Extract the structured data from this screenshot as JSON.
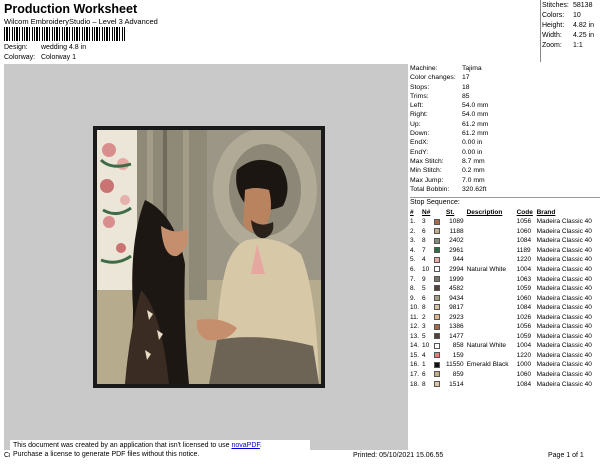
{
  "header": {
    "title": "Production Worksheet",
    "subtitle": "Wilcom EmbroideryStudio – Level 3 Advanced",
    "design_label": "Design:",
    "design_value": "wedding 4.8 in",
    "colorway_label": "Colorway:",
    "colorway_value": "Colorway 1"
  },
  "stats": [
    {
      "k": "Stitches:",
      "v": "58138"
    },
    {
      "k": "Colors:",
      "v": "10"
    },
    {
      "k": "Height:",
      "v": "4.82 in"
    },
    {
      "k": "Width:",
      "v": "4.25 in"
    },
    {
      "k": "Zoom:",
      "v": "1:1"
    }
  ],
  "machine_info": [
    {
      "k": "Machine:",
      "v": "Tajima"
    },
    {
      "k": "Color changes:",
      "v": "17"
    },
    {
      "k": "Stops:",
      "v": "18"
    },
    {
      "k": "Trims:",
      "v": "85"
    },
    {
      "k": "Left:",
      "v": "54.0 mm"
    },
    {
      "k": "Right:",
      "v": "54.0 mm"
    },
    {
      "k": "Up:",
      "v": "61.2 mm"
    },
    {
      "k": "Down:",
      "v": "61.2 mm"
    },
    {
      "k": "EndX:",
      "v": "0.00 in"
    },
    {
      "k": "EndY:",
      "v": "0.00 in"
    },
    {
      "k": "Max Stitch:",
      "v": "8.7 mm"
    },
    {
      "k": "Min Stitch:",
      "v": "0.2 mm"
    },
    {
      "k": "Max Jump:",
      "v": "7.0 mm"
    },
    {
      "k": "Total Bobbin:",
      "v": "320.62ft"
    }
  ],
  "stop_sequence": {
    "title": "Stop Sequence:",
    "headers": {
      "idx": "#",
      "n": "N#",
      "st": "St.",
      "desc": "Description",
      "code": "Code",
      "brand": "Brand"
    },
    "rows": [
      {
        "idx": "1.",
        "n": "3",
        "color": "#a86b4c",
        "st": "1089",
        "desc": "",
        "code": "1056",
        "brand": "Madeira Classic 40"
      },
      {
        "idx": "2.",
        "n": "6",
        "color": "#c6ad8a",
        "st": "1188",
        "desc": "",
        "code": "1060",
        "brand": "Madeira Classic 40"
      },
      {
        "idx": "3.",
        "n": "8",
        "color": "#8b8b7d",
        "st": "2402",
        "desc": "",
        "code": "1084",
        "brand": "Madeira Classic 40"
      },
      {
        "idx": "4.",
        "n": "7",
        "color": "#2f6f47",
        "st": "2961",
        "desc": "",
        "code": "1189",
        "brand": "Madeira Classic 40"
      },
      {
        "idx": "5.",
        "n": "4",
        "color": "#e8aaa4",
        "st": "944",
        "desc": "",
        "code": "1220",
        "brand": "Madeira Classic 40"
      },
      {
        "idx": "6.",
        "n": "10",
        "color": "#ffffff",
        "st": "2994",
        "desc": "Natural White",
        "code": "1004",
        "brand": "Madeira Classic 40"
      },
      {
        "idx": "7.",
        "n": "9",
        "color": "#7e756a",
        "st": "1999",
        "desc": "",
        "code": "1063",
        "brand": "Madeira Classic 40"
      },
      {
        "idx": "8.",
        "n": "5",
        "color": "#54413a",
        "st": "4582",
        "desc": "",
        "code": "1059",
        "brand": "Madeira Classic 40"
      },
      {
        "idx": "9.",
        "n": "6",
        "color": "#a6a086",
        "st": "9434",
        "desc": "",
        "code": "1060",
        "brand": "Madeira Classic 40"
      },
      {
        "idx": "10.",
        "n": "8",
        "color": "#d9c7a4",
        "st": "9817",
        "desc": "",
        "code": "1084",
        "brand": "Madeira Classic 40"
      },
      {
        "idx": "11.",
        "n": "2",
        "color": "#e0b98e",
        "st": "2923",
        "desc": "",
        "code": "1026",
        "brand": "Madeira Classic 40"
      },
      {
        "idx": "12.",
        "n": "3",
        "color": "#a86b4c",
        "st": "1386",
        "desc": "",
        "code": "1056",
        "brand": "Madeira Classic 40"
      },
      {
        "idx": "13.",
        "n": "5",
        "color": "#54413a",
        "st": "1477",
        "desc": "",
        "code": "1059",
        "brand": "Madeira Classic 40"
      },
      {
        "idx": "14.",
        "n": "10",
        "color": "#ffffff",
        "st": "858",
        "desc": "Natural White",
        "code": "1004",
        "brand": "Madeira Classic 40"
      },
      {
        "idx": "15.",
        "n": "4",
        "color": "#e07d7d",
        "st": "159",
        "desc": "",
        "code": "1220",
        "brand": "Madeira Classic 40"
      },
      {
        "idx": "16.",
        "n": "1",
        "color": "#111111",
        "st": "11550",
        "desc": "Emerald Black",
        "code": "1000",
        "brand": "Madeira Classic 40"
      },
      {
        "idx": "17.",
        "n": "6",
        "color": "#c6ad8a",
        "st": "859",
        "desc": "",
        "code": "1060",
        "brand": "Madeira Classic 40"
      },
      {
        "idx": "18.",
        "n": "8",
        "color": "#d9c7a4",
        "st": "1514",
        "desc": "",
        "code": "1084",
        "brand": "Madeira Classic 40"
      }
    ]
  },
  "notice": {
    "line1_prefix": "This document was created by an application that isn't licensed to use ",
    "link": "novaPDF",
    "line1_suffix": ".",
    "line2": "Purchase a license to generate PDF files without this notice."
  },
  "footer": {
    "left": "Cr",
    "printed": "Printed: 05/10/2021 15.06.55",
    "page": "Page 1 of 1"
  }
}
